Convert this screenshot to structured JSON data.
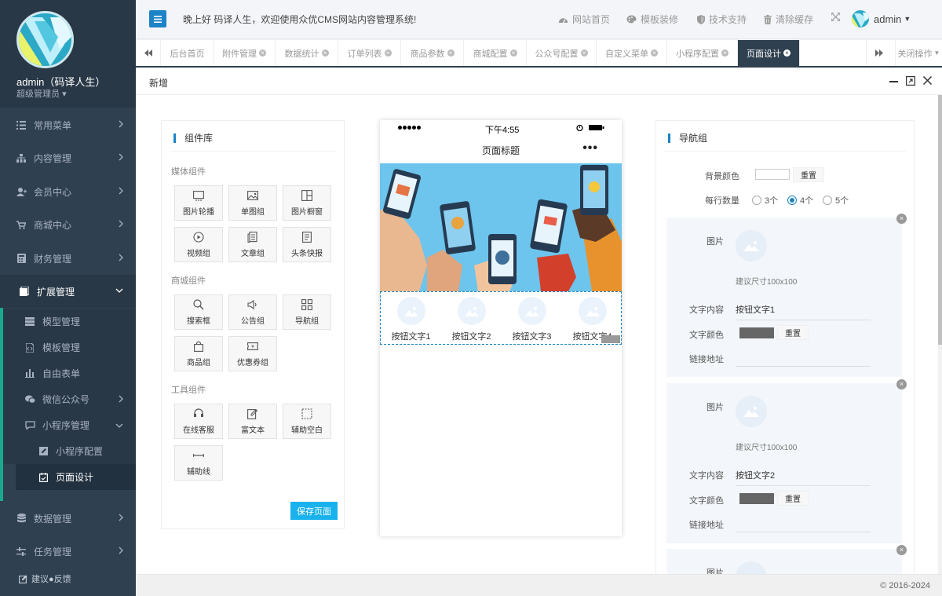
{
  "sidebar": {
    "user_name": "admin（码译人生）",
    "user_role": "超级管理员",
    "items": [
      {
        "label": "常用菜单",
        "icon": "list-icon"
      },
      {
        "label": "内容管理",
        "icon": "sitemap-icon"
      },
      {
        "label": "会员中心",
        "icon": "user-add-icon"
      },
      {
        "label": "商城中心",
        "icon": "cart-icon"
      },
      {
        "label": "财务管理",
        "icon": "calculator-icon"
      },
      {
        "label": "扩展管理",
        "icon": "puzzle-icon"
      },
      {
        "label": "数据管理",
        "icon": "database-icon"
      },
      {
        "label": "任务管理",
        "icon": "sliders-icon"
      }
    ],
    "sub_items": [
      {
        "label": "模型管理",
        "icon": "server-icon"
      },
      {
        "label": "模板管理",
        "icon": "file-code-icon"
      },
      {
        "label": "自由表单",
        "icon": "tree-icon"
      },
      {
        "label": "微信公众号",
        "icon": "wechat-icon"
      },
      {
        "label": "小程序管理",
        "icon": "chat-icon"
      }
    ],
    "sub2_items": [
      {
        "label": "小程序配置",
        "icon": "edit-icon"
      },
      {
        "label": "页面设计",
        "icon": "calendar-check-icon"
      }
    ],
    "feedback": "建议●反馈"
  },
  "header": {
    "welcome": "晚上好 码译人生，欢迎使用众优CMS网站内容管理系统!",
    "links": [
      "网站首页",
      "模板装修",
      "技术支持",
      "清除缓存"
    ],
    "admin_label": "admin"
  },
  "tabs": {
    "items": [
      "后台首页",
      "附件管理",
      "数据统计",
      "订单列表",
      "商品参数",
      "商城配置",
      "公众号配置",
      "自定义菜单",
      "小程序配置",
      "页面设计"
    ],
    "close_ops": "关闭操作"
  },
  "page": {
    "title": "新增"
  },
  "library": {
    "title": "组件库",
    "groups": [
      {
        "title": "媒体组件",
        "items": [
          "图片轮播",
          "单图组",
          "图片橱窗",
          "视频组",
          "文章组",
          "头条快报"
        ]
      },
      {
        "title": "商城组件",
        "items": [
          "搜索框",
          "公告组",
          "导航组",
          "商品组",
          "优惠券组"
        ]
      },
      {
        "title": "工具组件",
        "items": [
          "在线客服",
          "富文本",
          "辅助空白",
          "辅助线"
        ]
      }
    ],
    "save_label": "保存页面"
  },
  "phone": {
    "time": "下午4:55",
    "nav_title": "页面标题",
    "more": "•••",
    "nav_buttons": [
      "按钮文字1",
      "按钮文字2",
      "按钮文字3",
      "按钮文字4"
    ]
  },
  "settings": {
    "title": "导航组",
    "bg_color_label": "背景颜色",
    "reset": "重置",
    "per_row_label": "每行数量",
    "per_row_options": [
      "3个",
      "4个",
      "5个"
    ],
    "per_row_selected": "4个",
    "image_label": "图片",
    "size_hint": "建议尺寸100x100",
    "text_label": "文字内容",
    "text_color_label": "文字颜色",
    "link_label": "链接地址",
    "buttons": [
      {
        "text": "按钮文字1",
        "text_color": "#666666"
      },
      {
        "text": "按钮文字2",
        "text_color": "#666666"
      },
      {
        "text": "",
        "text_color": "#666666"
      }
    ]
  },
  "footer": {
    "copyright": "© 2016-2024"
  },
  "colors": {
    "sidebar": "#2f4050",
    "accent": "#1c84c6",
    "active_tab": "#2f4050",
    "save_button": "#1ab2ed"
  }
}
